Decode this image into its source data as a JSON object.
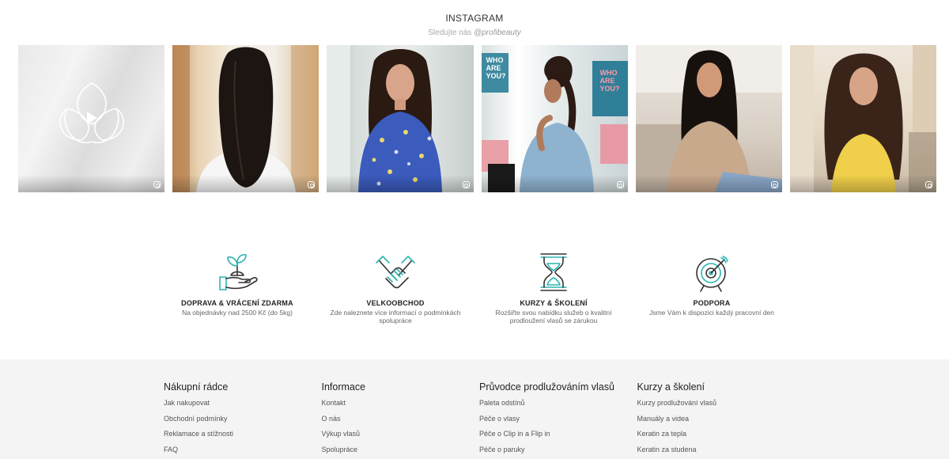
{
  "instagram": {
    "title": "INSTAGRAM",
    "subtitle": "Sledujte nás",
    "handle": "@profibeauty",
    "tiles": [
      {
        "kind": "video",
        "icon": "instagram-icon"
      },
      {
        "kind": "image",
        "icon": "instagram-icon"
      },
      {
        "kind": "image",
        "icon": "instagram-icon"
      },
      {
        "kind": "image",
        "icon": "instagram-icon",
        "poster_text": [
          "WHO",
          "ARE",
          "YOU?"
        ]
      },
      {
        "kind": "image",
        "icon": "instagram-icon"
      },
      {
        "kind": "image",
        "icon": "instagram-icon"
      }
    ]
  },
  "features": [
    {
      "icon": "plant-in-hand-icon",
      "title": "DOPRAVA & VRÁCENÍ ZDARMA",
      "desc": "Na objednávky nad 2500 Kč (do 5kg)"
    },
    {
      "icon": "handshake-icon",
      "title": "VELKOOBCHOD",
      "desc": "Zde naleznete více informací o podmínkách spolupráce"
    },
    {
      "icon": "hourglass-icon",
      "title": "KURZY & ŠKOLENÍ",
      "desc": "Rozšiřte svou nabídku služeb o kvalitní prodloužení vlasů se zárukou"
    },
    {
      "icon": "target-icon",
      "title": "PODPORA",
      "desc": "Jsme Vám k dispozici každý pracovní den"
    }
  ],
  "footer": {
    "columns": [
      {
        "heading": "Nákupní rádce",
        "links": [
          "Jak nakupovat",
          "Obchodní podmínky",
          "Reklamace a stížnosti",
          "FAQ"
        ]
      },
      {
        "heading": "Informace",
        "links": [
          "Kontakt",
          "O nás",
          "Výkup vlasů",
          "Spolupráce"
        ]
      },
      {
        "heading": "Průvodce prodlužováním vlasů",
        "links": [
          "Paleta odstínů",
          "Péče o vlasy",
          "Péče o Clip in a Flip in",
          "Péče o paruky"
        ]
      },
      {
        "heading": "Kurzy a školení",
        "links": [
          "Kurzy prodlužování vlasů",
          "Manuály a videa",
          "Keratin za tepla",
          "Keratin za studena"
        ]
      }
    ]
  },
  "colors": {
    "accent": "#2bb5b0",
    "icon_dark": "#333333",
    "footer_bg": "#f4f4f4"
  }
}
